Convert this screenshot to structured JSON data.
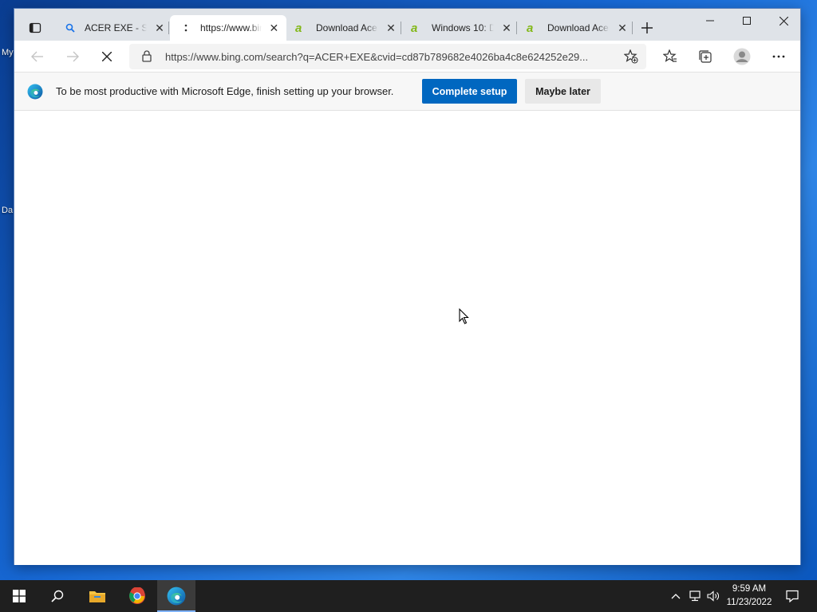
{
  "desktop": {
    "icon_labels": [
      "My",
      "Da"
    ]
  },
  "browser": {
    "tabs": [
      {
        "title": "ACER EXE - Search",
        "icon": "search-icon",
        "active": false
      },
      {
        "title": "https://www.bing.com",
        "icon": "loading-dots-icon",
        "active": true
      },
      {
        "title": "Download Acer",
        "icon": "acer-logo-icon",
        "active": false
      },
      {
        "title": "Windows 10: D",
        "icon": "acer-logo-icon",
        "active": false
      },
      {
        "title": "Download Acer",
        "icon": "acer-logo-icon",
        "active": false
      }
    ],
    "address": "https://www.bing.com/search?q=ACER+EXE&cvid=cd87b789682e4026ba4c8e624252e29...",
    "infobar": {
      "message": "To be most productive with Microsoft Edge, finish setting up your browser.",
      "primary_button": "Complete setup",
      "secondary_button": "Maybe later"
    },
    "colors": {
      "accent": "#0067c0",
      "acer_green": "#83b81a"
    }
  },
  "taskbar": {
    "time": "9:59 AM",
    "date": "11/23/2022",
    "pinned": [
      "windows-start-icon",
      "search-icon",
      "file-explorer-icon",
      "chrome-icon",
      "edge-icon"
    ]
  }
}
